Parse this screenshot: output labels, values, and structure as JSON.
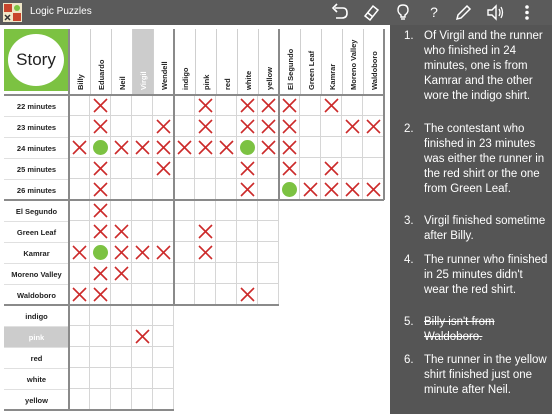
{
  "app": {
    "title": "Logic Puzzles"
  },
  "toolbar": {
    "help_label": "?"
  },
  "story_button": {
    "label": "Story"
  },
  "columns": [
    {
      "label": "Billy",
      "highlighted": false
    },
    {
      "label": "Eduardo",
      "highlighted": false
    },
    {
      "label": "Neil",
      "highlighted": false
    },
    {
      "label": "Virgil",
      "highlighted": true
    },
    {
      "label": "Wendell",
      "highlighted": false
    },
    {
      "label": "indigo",
      "highlighted": false
    },
    {
      "label": "pink",
      "highlighted": false
    },
    {
      "label": "red",
      "highlighted": false
    },
    {
      "label": "white",
      "highlighted": false
    },
    {
      "label": "yellow",
      "highlighted": false
    },
    {
      "label": "El Segundo",
      "highlighted": false
    },
    {
      "label": "Green Leaf",
      "highlighted": false
    },
    {
      "label": "Kamrar",
      "highlighted": false
    },
    {
      "label": "Moreno Valley",
      "highlighted": false
    },
    {
      "label": "Waldoboro",
      "highlighted": false
    }
  ],
  "rows": [
    {
      "label": "22 minutes",
      "highlighted": false,
      "cells": [
        "",
        "X",
        "",
        "",
        "",
        "",
        "X",
        "",
        "X",
        "X",
        "X",
        "",
        "X",
        "",
        ""
      ]
    },
    {
      "label": "23 minutes",
      "highlighted": false,
      "cells": [
        "",
        "X",
        "",
        "",
        "X",
        "",
        "X",
        "",
        "X",
        "X",
        "X",
        "",
        "",
        "X",
        "X"
      ]
    },
    {
      "label": "24 minutes",
      "highlighted": false,
      "cells": [
        "X",
        "O",
        "X",
        "X",
        "X",
        "X",
        "X",
        "X",
        "O",
        "X",
        "X",
        "",
        "",
        "",
        ""
      ]
    },
    {
      "label": "25 minutes",
      "highlighted": false,
      "cells": [
        "",
        "X",
        "",
        "",
        "X",
        "",
        "",
        "",
        "X",
        "",
        "X",
        "",
        "X",
        "",
        ""
      ]
    },
    {
      "label": "26 minutes",
      "highlighted": false,
      "cells": [
        "",
        "X",
        "",
        "",
        "",
        "",
        "",
        "",
        "X",
        "",
        "O",
        "X",
        "X",
        "X",
        "X"
      ]
    },
    {
      "label": "El Segundo",
      "highlighted": false,
      "cells": [
        "",
        "X",
        "",
        "",
        "",
        "",
        "",
        "",
        "",
        ""
      ]
    },
    {
      "label": "Green Leaf",
      "highlighted": false,
      "cells": [
        "",
        "X",
        "X",
        "",
        "",
        "",
        "X",
        "",
        "",
        ""
      ]
    },
    {
      "label": "Kamrar",
      "highlighted": false,
      "cells": [
        "X",
        "O",
        "X",
        "X",
        "X",
        "",
        "X",
        "",
        "",
        ""
      ]
    },
    {
      "label": "Moreno Valley",
      "highlighted": false,
      "cells": [
        "",
        "X",
        "X",
        "",
        "",
        "",
        "",
        "",
        "",
        ""
      ]
    },
    {
      "label": "Waldoboro",
      "highlighted": false,
      "cells": [
        "X",
        "X",
        "",
        "",
        "",
        "",
        "",
        "",
        "X",
        ""
      ]
    },
    {
      "label": "indigo",
      "highlighted": false,
      "cells": [
        "",
        "",
        "",
        "",
        ""
      ]
    },
    {
      "label": "pink",
      "highlighted": true,
      "cells": [
        "",
        "",
        "",
        "X",
        ""
      ]
    },
    {
      "label": "red",
      "highlighted": false,
      "cells": [
        "",
        "",
        "",
        "",
        ""
      ]
    },
    {
      "label": "white",
      "highlighted": false,
      "cells": [
        "",
        "",
        "",
        "",
        ""
      ]
    },
    {
      "label": "yellow",
      "highlighted": false,
      "cells": [
        "",
        "",
        "",
        "",
        ""
      ]
    }
  ],
  "clues": [
    {
      "number": "1.",
      "text": "Of Virgil and the runner who finished in 24 minutes, one is from Kamrar and the other wore the indigo shirt.",
      "done": false
    },
    {
      "number": "2.",
      "text": "The contestant who finished in 23 minutes was either the runner in the red shirt or the one from Green Leaf.",
      "done": false
    },
    {
      "number": "3.",
      "text": "Virgil finished sometime after Billy.",
      "done": false
    },
    {
      "number": "4.",
      "text": "The runner who finished in 25 minutes didn't wear the red shirt.",
      "done": false
    },
    {
      "number": "5.",
      "text": "Billy isn't from Waldoboro.",
      "done": true
    },
    {
      "number": "6.",
      "text": "The runner in the yellow shirt finished just one minute after Neil.",
      "done": false
    }
  ],
  "colors": {
    "accent": "#7cc242",
    "mark_x": "#cc2a2a",
    "topbar": "#5b5b5b",
    "panel": "#555555",
    "highlight": "#cccccc"
  },
  "icons": [
    "app-icon",
    "undo-icon",
    "eraser-icon",
    "hint-bulb-icon",
    "help-icon",
    "pencil-icon",
    "sound-icon",
    "more-vert-icon"
  ]
}
